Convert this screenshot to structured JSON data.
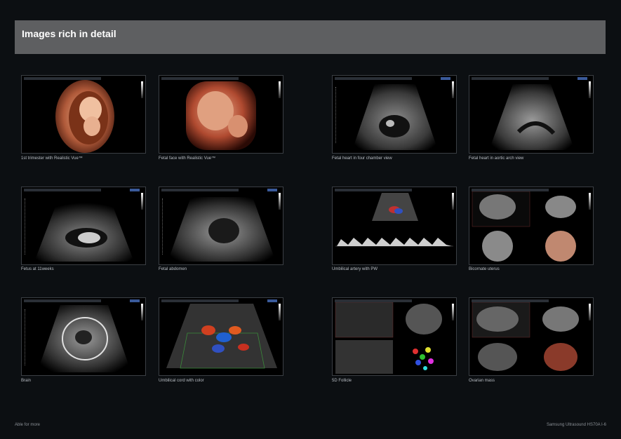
{
  "header": {
    "title": "Images rich in detail"
  },
  "images": [
    {
      "caption": "1st trimester with Realistic Vue™",
      "icon": "3d-fetus-first-trimester"
    },
    {
      "caption": "Fetal face with Realistic Vue™",
      "icon": "3d-fetal-face"
    },
    {
      "caption": "Fetal heart in four chamber view",
      "icon": "ultrasound-heart-four-chamber"
    },
    {
      "caption": "Fetal heart in aortic arch view",
      "icon": "ultrasound-aortic-arch"
    },
    {
      "caption": "Fetus at 11weeks",
      "icon": "ultrasound-fetus-11-weeks"
    },
    {
      "caption": "Fetal abdomen",
      "icon": "ultrasound-fetal-abdomen"
    },
    {
      "caption": "Umbilical artery with PW",
      "icon": "doppler-pw-waveform"
    },
    {
      "caption": "Bicornate uterus",
      "icon": "multiplanar-uterus"
    },
    {
      "caption": "Brain",
      "icon": "ultrasound-brain"
    },
    {
      "caption": "Umbilical cord with color",
      "icon": "color-doppler-cord"
    },
    {
      "caption": "5D Follicle",
      "icon": "multiplanar-follicle"
    },
    {
      "caption": "Ovarian mass",
      "icon": "multiplanar-ovarian-mass"
    }
  ],
  "footer": {
    "left": "Able for more",
    "right": "Samsung Ultrasound HS70A  I-6"
  }
}
